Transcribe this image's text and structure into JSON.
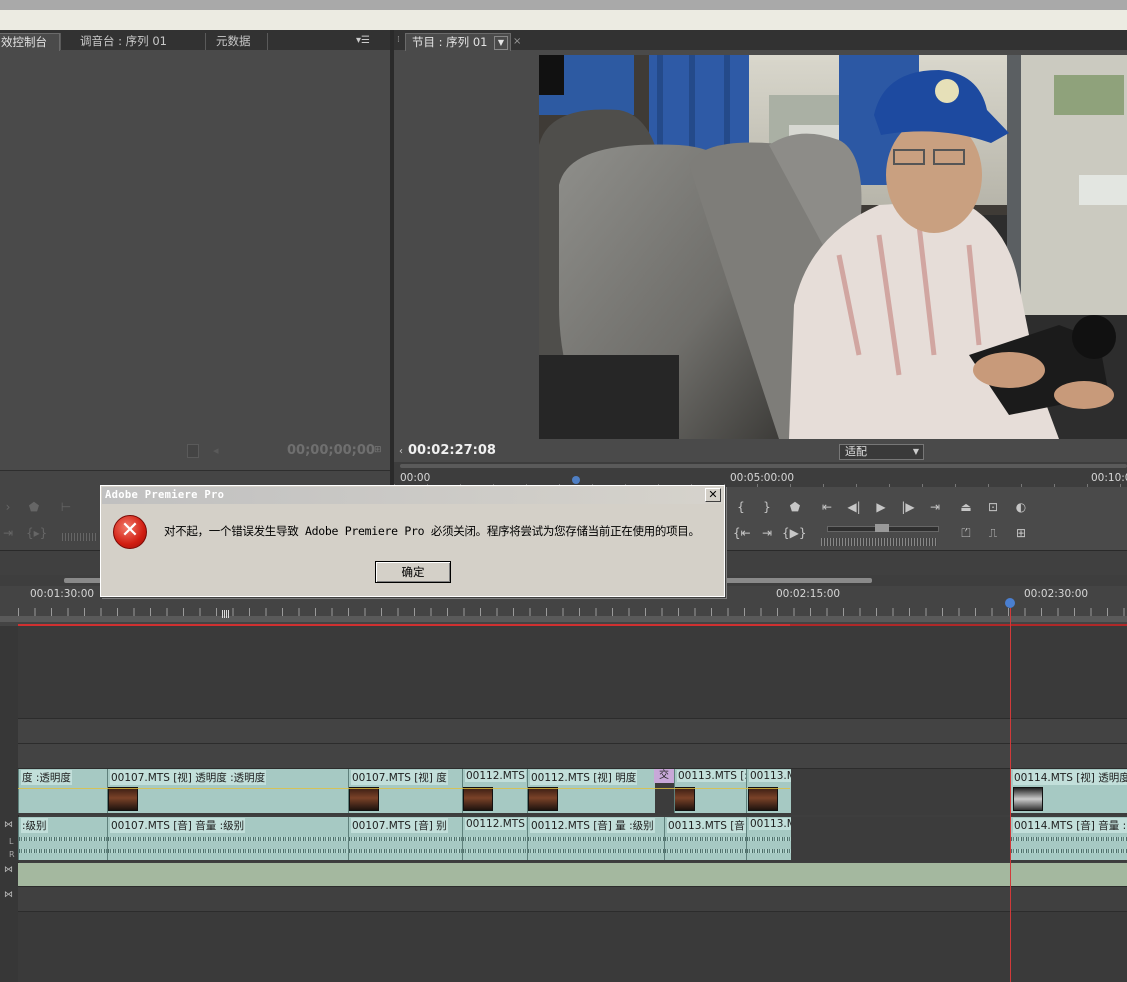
{
  "os": {},
  "left_panel": {
    "tabs": [
      "效控制台",
      "调音台 : 序列 01",
      "元数据"
    ],
    "timecode": "00;00;00;00"
  },
  "program_monitor": {
    "tab_label": "节目 : 序列 01",
    "timecode": "00:02:27:08",
    "fit_label": "适配",
    "ruler": [
      "00:00",
      "00:05:00:00",
      "00:10:0"
    ]
  },
  "timeline": {
    "ruler": [
      "00:01:30:00",
      "00:02:15:00",
      "00:02:30:00"
    ],
    "video_clips": [
      {
        "name": "度 :透明度"
      },
      {
        "name": "00107.MTS [视] 透明度 :透明度"
      },
      {
        "name": "00107.MTS [视] 度"
      },
      {
        "name": "00112.MTS"
      },
      {
        "name": "00112.MTS [视] 明度"
      },
      {
        "name": "交"
      },
      {
        "name": "00113.MTS [:"
      },
      {
        "name": "00113.M"
      },
      {
        "name": "00114.MTS [视] 透明度"
      }
    ],
    "audio_clips": [
      {
        "name": ":级别"
      },
      {
        "name": "00107.MTS [音] 音量 :级别"
      },
      {
        "name": "00107.MTS [音] 别"
      },
      {
        "name": "00112.MTS"
      },
      {
        "name": "00112.MTS [音] 量 :级别"
      },
      {
        "name": "00113.MTS [音"
      },
      {
        "name": "00113.M"
      },
      {
        "name": "00114.MTS [音] 音量 :"
      }
    ],
    "audio_channel_labels": [
      "L",
      "R"
    ]
  },
  "dialog": {
    "title": "Adobe Premiere Pro",
    "message": "对不起，一个错误发生导致 Adobe Premiere Pro 必须关闭。程序将尝试为您存储当前正在使用的项目。",
    "ok_label": "确定",
    "close_glyph": "✕",
    "icon_glyph": "✕"
  }
}
